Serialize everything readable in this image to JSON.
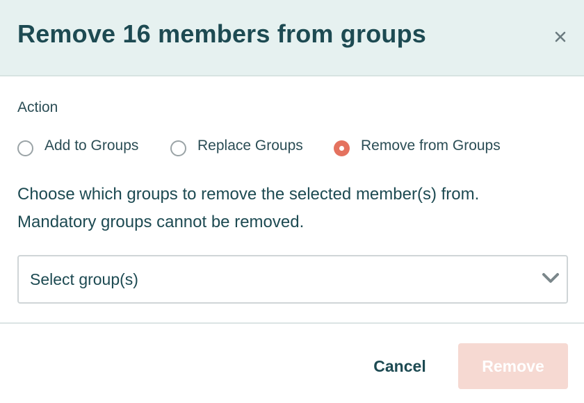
{
  "dialog": {
    "title": "Remove 16 members from groups",
    "close_icon": "close-icon"
  },
  "action": {
    "label": "Action",
    "options": [
      {
        "label": "Add to Groups",
        "selected": false
      },
      {
        "label": "Replace Groups",
        "selected": false
      },
      {
        "label": "Remove from Groups",
        "selected": true
      }
    ]
  },
  "description": {
    "line1": "Choose which groups to remove the selected member(s) from.",
    "line2": "Mandatory groups cannot be removed."
  },
  "group_select": {
    "placeholder": "Select group(s)",
    "icon": "chevron-down-icon"
  },
  "footer": {
    "cancel_label": "Cancel",
    "remove_label": "Remove",
    "remove_disabled": true
  },
  "colors": {
    "header_bg": "#e6f1f0",
    "title_text": "#1d4a52",
    "accent": "#e4725f",
    "remove_disabled_bg": "#f6d9d2"
  }
}
